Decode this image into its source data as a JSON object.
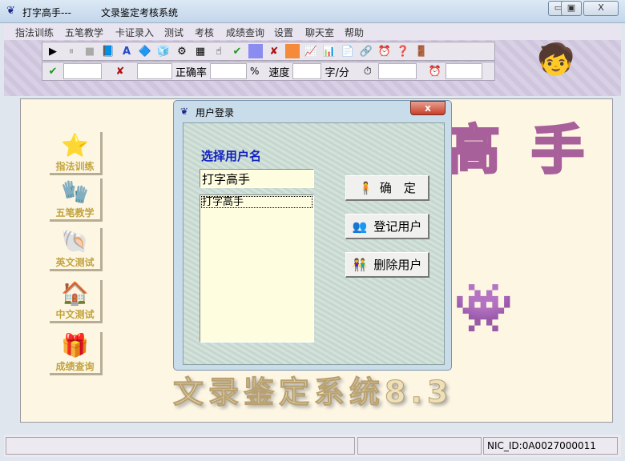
{
  "window": {
    "title": "打字高手---",
    "subtitle": "文录鉴定考核系统",
    "min": "▭",
    "max": "▣",
    "close": "X"
  },
  "menu": [
    "指法训练",
    "五笔教学",
    "卡证录入",
    "测试",
    "考核",
    "成绩查询",
    "设置",
    "聊天室",
    "帮助"
  ],
  "stats": {
    "rate_label": "正确率",
    "rate_unit": "%",
    "speed_label": "速度",
    "speed_unit": "字/分"
  },
  "sidebar": [
    "指法训练",
    "五笔教学",
    "英文测试",
    "中文测试",
    "成绩查询"
  ],
  "banner": {
    "title": "高 手",
    "subtitle": "文录鉴定系统8.3"
  },
  "dialog": {
    "title": "用户登录",
    "label": "选择用户名",
    "input_value": "打字高手",
    "list": [
      "打字高手"
    ],
    "ok": "确　定",
    "register": "登记用户",
    "delete": "删除用户",
    "close": "x"
  },
  "status": {
    "nic": "NIC_ID:0A0027000011"
  }
}
